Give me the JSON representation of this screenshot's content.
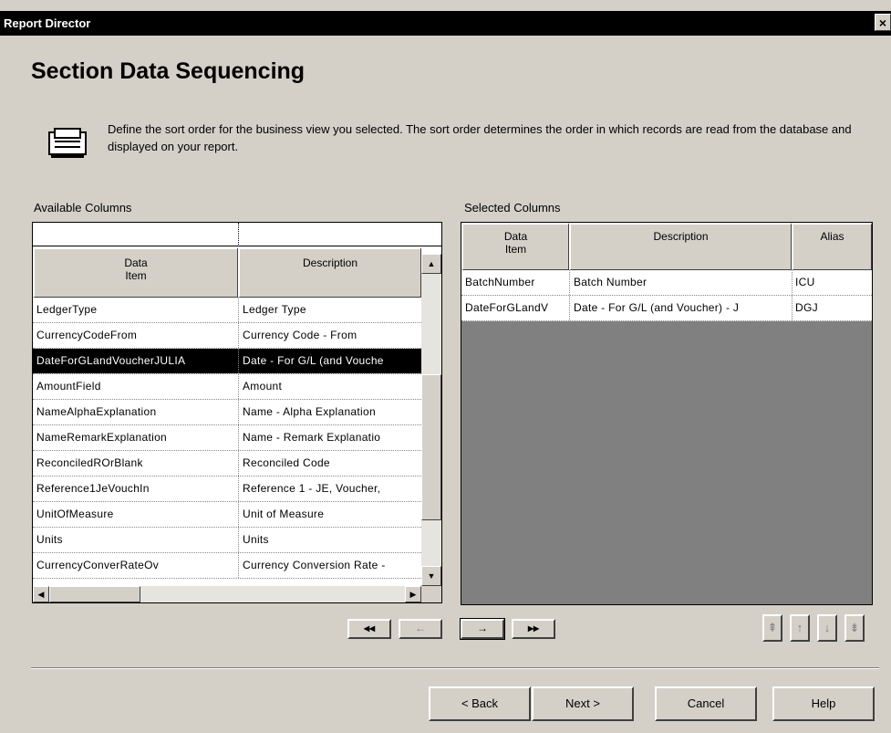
{
  "window": {
    "title": "Report Director",
    "close_glyph": "×"
  },
  "page": {
    "title": "Section Data Sequencing",
    "icon": "print-sequence-icon",
    "instructions": "Define the sort order for the business view you selected.  The sort order determines the order in which records are read from the database and displayed on your report."
  },
  "available": {
    "label": "Available Columns",
    "headers": {
      "data_item": "Data\nItem",
      "description": "Description"
    },
    "rows": [
      {
        "data_item": "LedgerType",
        "description": "Ledger Type"
      },
      {
        "data_item": "CurrencyCodeFrom",
        "description": "Currency Code - From"
      },
      {
        "data_item": "DateForGLandVoucherJULIA",
        "description": "Date - For G/L (and Vouche"
      },
      {
        "data_item": "AmountField",
        "description": "Amount"
      },
      {
        "data_item": "NameAlphaExplanation",
        "description": "Name - Alpha Explanation"
      },
      {
        "data_item": "NameRemarkExplanation",
        "description": "Name - Remark Explanatio"
      },
      {
        "data_item": "ReconciledROrBlank",
        "description": "Reconciled Code"
      },
      {
        "data_item": "Reference1JeVouchIn",
        "description": "Reference 1 - JE, Voucher,"
      },
      {
        "data_item": "UnitOfMeasure",
        "description": "Unit of Measure"
      },
      {
        "data_item": "Units",
        "description": "Units"
      },
      {
        "data_item": "CurrencyConverRateOv",
        "description": "Currency Conversion Rate -"
      }
    ],
    "selected_index": 2
  },
  "selected": {
    "label": "Selected Columns",
    "headers": {
      "data_item": "Data\nItem",
      "description": "Description",
      "alias": "Alias"
    },
    "rows": [
      {
        "data_item": "BatchNumber",
        "description": "Batch Number",
        "alias": "ICU"
      },
      {
        "data_item": "DateForGLandV",
        "description": "Date - For G/L (and Voucher) - J",
        "alias": "DGJ"
      }
    ]
  },
  "move_buttons": {
    "remove_all": "◂◂",
    "remove": "←",
    "add": "→",
    "add_all": "▸▸"
  },
  "order_buttons": {
    "top": "⇞",
    "up": "↑",
    "down": "↓",
    "bottom": "⇟"
  },
  "footer": {
    "back": "< Back",
    "next": "Next >",
    "cancel": "Cancel",
    "help": "Help"
  }
}
